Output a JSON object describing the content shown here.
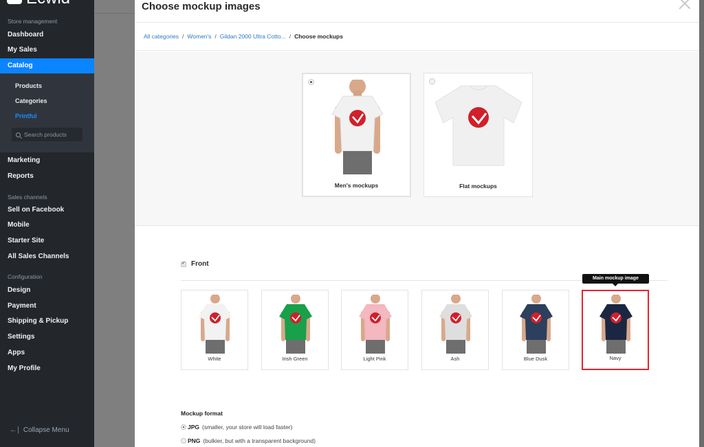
{
  "sidebar": {
    "logo_text": "Ecwid",
    "sections": {
      "store_management": "Store management",
      "sales_channels": "Sales channels",
      "configuration": "Configuration"
    },
    "items": {
      "dashboard": "Dashboard",
      "my_sales": "My Sales",
      "catalog": "Catalog",
      "marketing": "Marketing",
      "reports": "Reports",
      "sell_on_facebook": "Sell on Facebook",
      "mobile": "Mobile",
      "starter_site": "Starter Site",
      "all_sales_channels": "All Sales Channels",
      "design": "Design",
      "payment": "Payment",
      "shipping_pickup": "Shipping & Pickup",
      "settings": "Settings",
      "apps": "Apps",
      "my_profile": "My Profile"
    },
    "catalog_sub": {
      "products": "Products",
      "categories": "Categories",
      "printful": "Printful"
    },
    "search_placeholder": "Search products",
    "collapse_label": "Collapse Menu",
    "active_item": "Catalog",
    "accent_color": "#0a84ff"
  },
  "modal": {
    "title": "Choose mockup images",
    "breadcrumb": {
      "items": [
        "All categories",
        "Women's",
        "Gildan 2000 Ultra Cotto..."
      ],
      "separator": "/",
      "current": "Choose mockups"
    },
    "mockup_types": [
      {
        "label": "Men's mockups",
        "selected": true
      },
      {
        "label": "Flat mockups",
        "selected": false
      }
    ],
    "front": {
      "label": "Front",
      "checked": true
    },
    "colors": [
      {
        "name": "White",
        "shirt_color": "#f2f2f2"
      },
      {
        "name": "Irish Green",
        "shirt_color": "#18a04a"
      },
      {
        "name": "Light Pink",
        "shirt_color": "#f3b8c0"
      },
      {
        "name": "Ash",
        "shirt_color": "#dedede"
      },
      {
        "name": "Blue Dusk",
        "shirt_color": "#2c3f5f"
      },
      {
        "name": "Navy",
        "shirt_color": "#1b2742"
      }
    ],
    "main_image_tooltip": "Main mockup image",
    "main_image_color": "Navy",
    "format": {
      "title": "Mockup format",
      "options": [
        {
          "name": "JPG",
          "desc": "(smaller, your store will load faster)",
          "selected": true
        },
        {
          "name": "PNG",
          "desc": "(bulkier, but with a transparent background)",
          "selected": false
        }
      ]
    },
    "highlight_color": "#e8232e"
  }
}
